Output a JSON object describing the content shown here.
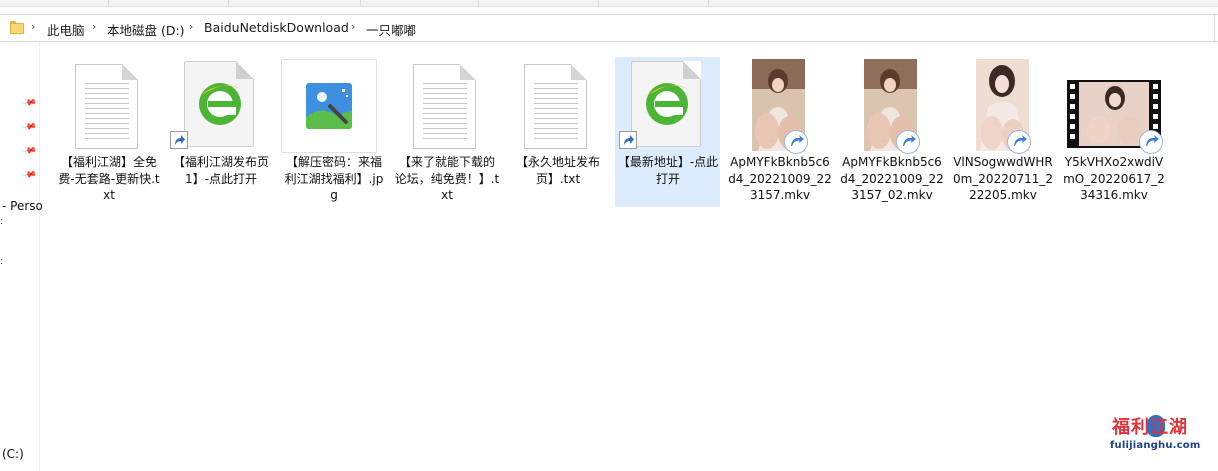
{
  "breadcrumb": {
    "items": [
      "此电脑",
      "本地磁盘 (D:)",
      "BaiduNetdiskDownload",
      "一只嘟嘟"
    ],
    "separator": "›"
  },
  "navpane": {
    "partial_label_1": "- Perso",
    "partial_label_2": "(C:)"
  },
  "files": [
    {
      "name": "【福利江湖】全免费-无套路-更新快.txt",
      "type": "text-document",
      "icon": "text-file-icon"
    },
    {
      "name": "【福利江湖发布页1】-点此打开",
      "type": "internet-shortcut",
      "icon": "ie-shortcut-icon"
    },
    {
      "name": "【解压密码：来福利江湖找福利】.jpg",
      "type": "image",
      "icon": "image-file-icon"
    },
    {
      "name": "【来了就能下载的论坛，纯免费！】.txt",
      "type": "text-document",
      "icon": "text-file-icon"
    },
    {
      "name": "【永久地址发布页】.txt",
      "type": "text-document",
      "icon": "text-file-icon"
    },
    {
      "name": "【最新地址】-点此打开",
      "type": "internet-shortcut",
      "icon": "ie-shortcut-icon",
      "selected": true
    },
    {
      "name": "ApMYFkBknb5c6d4_20221009_223157.mkv",
      "type": "video",
      "icon": "video-thumbnail"
    },
    {
      "name": "ApMYFkBknb5c6d4_20221009_223157_02.mkv",
      "type": "video",
      "icon": "video-thumbnail"
    },
    {
      "name": "VlNSogwwdWHR0m_20220711_222205.mkv",
      "type": "video",
      "icon": "video-thumbnail"
    },
    {
      "name": "Y5kVHXo2xwdiVmO_20220617_234316.mkv",
      "type": "video",
      "icon": "video-thumbnail"
    }
  ],
  "watermark": {
    "title": "福利江湖",
    "url": "fulijianghu.com"
  },
  "colors": {
    "selection": "#dcecfc",
    "ie_green": "#3aa02a",
    "watermark_red": "#e0333a",
    "watermark_blue": "#2b74c9"
  }
}
